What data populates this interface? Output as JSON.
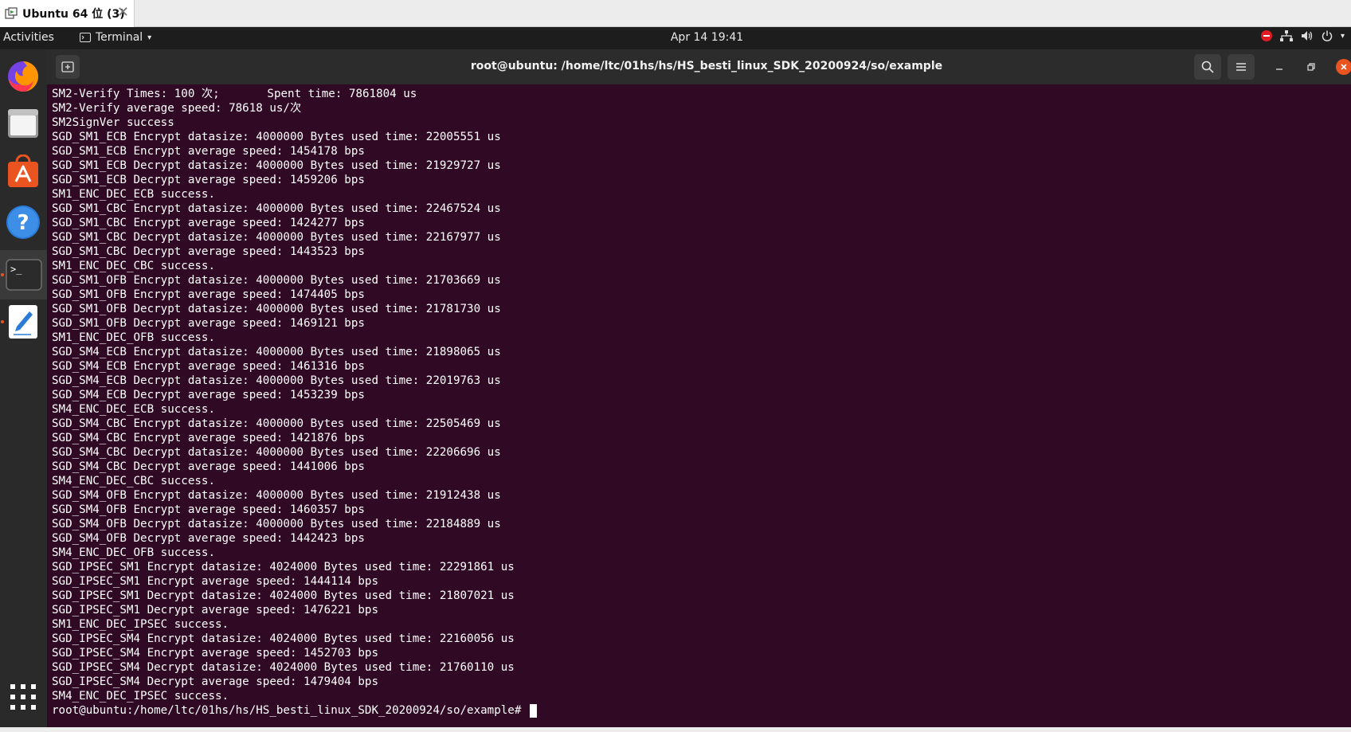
{
  "vm_tab": {
    "label": "Ubuntu 64 位 (3)",
    "close_glyph": "✕"
  },
  "topbar": {
    "activities": "Activities",
    "app_name": "Terminal",
    "caret": "▾",
    "clock": "Apr 14  19:41",
    "tray_caret": "▾"
  },
  "dock": {
    "items": [
      "firefox-icon",
      "files-icon",
      "software-center-icon",
      "help-icon",
      "terminal-icon",
      "text-editor-icon",
      "show-apps-icon"
    ],
    "terminal_glyph": ">_",
    "help_glyph": "?"
  },
  "terminal": {
    "title": "root@ubuntu: /home/ltc/01hs/hs/HS_besti_linux_SDK_20200924/so/example",
    "lines": [
      "SM2-Verify Times: 100 次;       Spent time: 7861804 us",
      "SM2-Verify average speed: 78618 us/次",
      "SM2SignVer success",
      "SGD_SM1_ECB Encrypt datasize: 4000000 Bytes used time: 22005551 us",
      "SGD_SM1_ECB Encrypt average speed: 1454178 bps",
      "SGD_SM1_ECB Decrypt datasize: 4000000 Bytes used time: 21929727 us",
      "SGD_SM1_ECB Decrypt average speed: 1459206 bps",
      "SM1_ENC_DEC_ECB success.",
      "SGD_SM1_CBC Encrypt datasize: 4000000 Bytes used time: 22467524 us",
      "SGD_SM1_CBC Encrypt average speed: 1424277 bps",
      "SGD_SM1_CBC Decrypt datasize: 4000000 Bytes used time: 22167977 us",
      "SGD_SM1_CBC Decrypt average speed: 1443523 bps",
      "SM1_ENC_DEC_CBC success.",
      "SGD_SM1_OFB Encrypt datasize: 4000000 Bytes used time: 21703669 us",
      "SGD_SM1_OFB Encrypt average speed: 1474405 bps",
      "SGD_SM1_OFB Decrypt datasize: 4000000 Bytes used time: 21781730 us",
      "SGD_SM1_OFB Decrypt average speed: 1469121 bps",
      "SM1_ENC_DEC_OFB success.",
      "SGD_SM4_ECB Encrypt datasize: 4000000 Bytes used time: 21898065 us",
      "SGD_SM4_ECB Encrypt average speed: 1461316 bps",
      "SGD_SM4_ECB Decrypt datasize: 4000000 Bytes used time: 22019763 us",
      "SGD_SM4_ECB Decrypt average speed: 1453239 bps",
      "SM4_ENC_DEC_ECB success.",
      "SGD_SM4_CBC Encrypt datasize: 4000000 Bytes used time: 22505469 us",
      "SGD_SM4_CBC Encrypt average speed: 1421876 bps",
      "SGD_SM4_CBC Decrypt datasize: 4000000 Bytes used time: 22206696 us",
      "SGD_SM4_CBC Decrypt average speed: 1441006 bps",
      "SM4_ENC_DEC_CBC success.",
      "SGD_SM4_OFB Encrypt datasize: 4000000 Bytes used time: 21912438 us",
      "SGD_SM4_OFB Encrypt average speed: 1460357 bps",
      "SGD_SM4_OFB Decrypt datasize: 4000000 Bytes used time: 22184889 us",
      "SGD_SM4_OFB Decrypt average speed: 1442423 bps",
      "SM4_ENC_DEC_OFB success.",
      "SGD_IPSEC_SM1 Encrypt datasize: 4024000 Bytes used time: 22291861 us",
      "SGD_IPSEC_SM1 Encrypt average speed: 1444114 bps",
      "SGD_IPSEC_SM1 Decrypt datasize: 4024000 Bytes used time: 21807021 us",
      "SGD_IPSEC_SM1 Decrypt average speed: 1476221 bps",
      "SM1_ENC_DEC_IPSEC success.",
      "SGD_IPSEC_SM4 Encrypt datasize: 4024000 Bytes used time: 22160056 us",
      "SGD_IPSEC_SM4 Encrypt average speed: 1452703 bps",
      "SGD_IPSEC_SM4 Decrypt datasize: 4024000 Bytes used time: 21760110 us",
      "SGD_IPSEC_SM4 Decrypt average speed: 1479404 bps",
      "SM4_ENC_DEC_IPSEC success."
    ],
    "prompt": "root@ubuntu:/home/ltc/01hs/hs/HS_besti_linux_SDK_20200924/so/example# "
  },
  "colors": {
    "terminal_bg": "#300a24",
    "accent": "#e95420",
    "topbar_bg": "#1d1d1d"
  }
}
